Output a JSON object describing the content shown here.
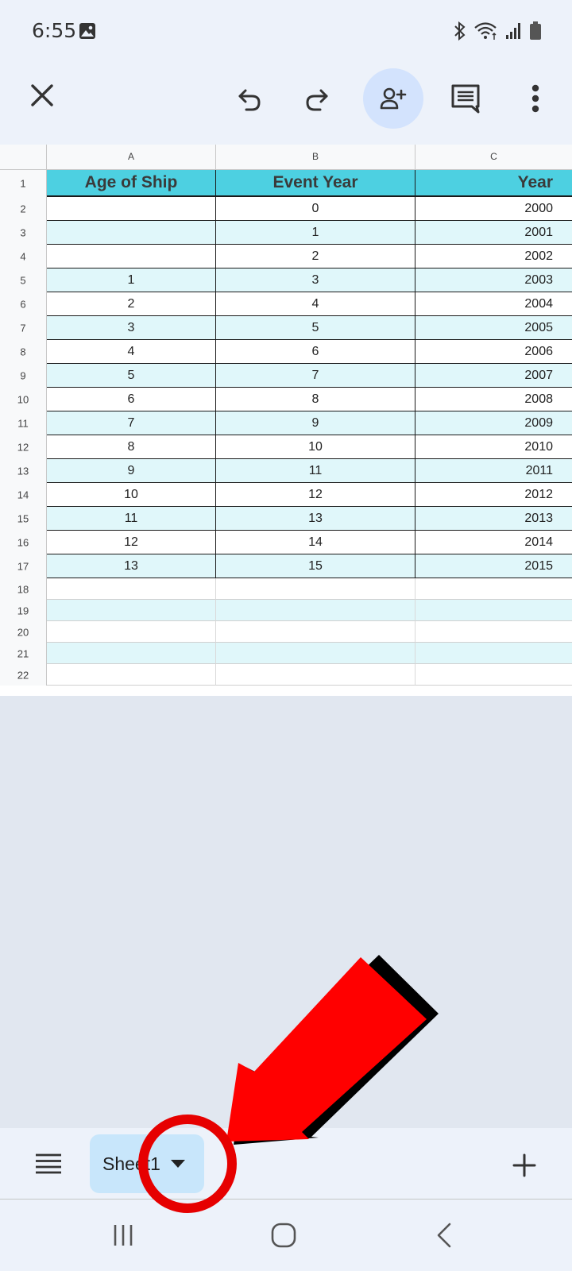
{
  "status": {
    "time": "6:55"
  },
  "toolbar": {
    "icons": [
      "close-icon",
      "undo-icon",
      "redo-icon",
      "add-person-icon",
      "comment-icon",
      "more-vert-icon"
    ]
  },
  "grid": {
    "columns": [
      "A",
      "B",
      "C"
    ],
    "row_numbers": [
      "1",
      "2",
      "3",
      "4",
      "5",
      "6",
      "7",
      "8",
      "9",
      "10",
      "11",
      "12",
      "13",
      "14",
      "15",
      "16",
      "17",
      "18",
      "19",
      "20",
      "21",
      "22"
    ],
    "header": {
      "a": "Age of Ship",
      "b": "Event Year",
      "c": "Year"
    },
    "rows": [
      {
        "a": "",
        "b": "0",
        "c": "2000"
      },
      {
        "a": "",
        "b": "1",
        "c": "2001"
      },
      {
        "a": "",
        "b": "2",
        "c": "2002"
      },
      {
        "a": "1",
        "b": "3",
        "c": "2003"
      },
      {
        "a": "2",
        "b": "4",
        "c": "2004"
      },
      {
        "a": "3",
        "b": "5",
        "c": "2005"
      },
      {
        "a": "4",
        "b": "6",
        "c": "2006"
      },
      {
        "a": "5",
        "b": "7",
        "c": "2007"
      },
      {
        "a": "6",
        "b": "8",
        "c": "2008"
      },
      {
        "a": "7",
        "b": "9",
        "c": "2009"
      },
      {
        "a": "8",
        "b": "10",
        "c": "2010"
      },
      {
        "a": "9",
        "b": "11",
        "c": "2011"
      },
      {
        "a": "10",
        "b": "12",
        "c": "2012"
      },
      {
        "a": "11",
        "b": "13",
        "c": "2013"
      },
      {
        "a": "12",
        "b": "14",
        "c": "2014"
      },
      {
        "a": "13",
        "b": "15",
        "c": "2015"
      }
    ],
    "colors": {
      "header_fill": "#4dd0e1",
      "band_fill": "#e0f7fa",
      "white_fill": "#ffffff"
    }
  },
  "sheets": {
    "active": "Sheet1"
  },
  "annotation": {
    "arrow_color": "#ff0000",
    "circle_color": "#e60000"
  }
}
